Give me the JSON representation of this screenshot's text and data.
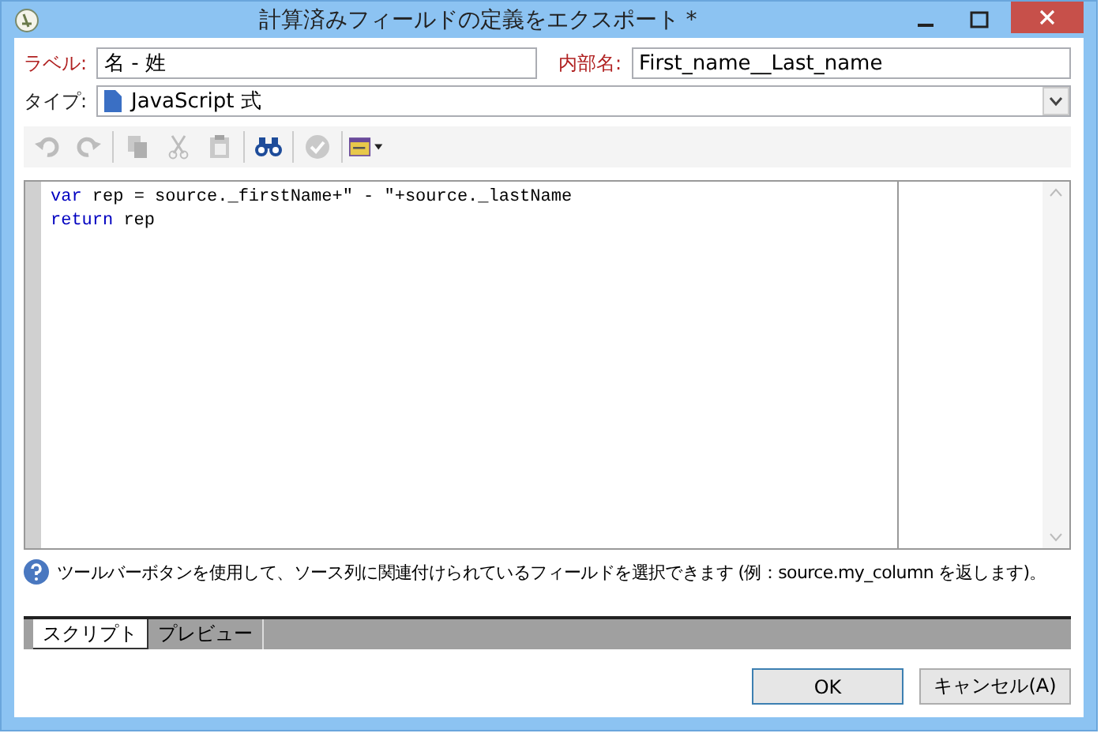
{
  "window": {
    "title": "計算済みフィールドの定義をエクスポート *"
  },
  "label_field": {
    "label": "ラベル:",
    "value": "名 - 姓"
  },
  "internal_name_field": {
    "label": "内部名:",
    "value": "First_name__Last_name"
  },
  "type_field": {
    "label": "タイプ:",
    "value": "JavaScript 式"
  },
  "toolbar": [
    {
      "kind": "undo",
      "disabled": true
    },
    {
      "kind": "redo",
      "disabled": true
    },
    {
      "kind": "sep"
    },
    {
      "kind": "copy",
      "disabled": true
    },
    {
      "kind": "cut",
      "disabled": true
    },
    {
      "kind": "paste",
      "disabled": true
    },
    {
      "kind": "sep"
    },
    {
      "kind": "find",
      "disabled": false
    },
    {
      "kind": "sep"
    },
    {
      "kind": "check",
      "disabled": true
    },
    {
      "kind": "sep"
    },
    {
      "kind": "fields",
      "disabled": false
    }
  ],
  "code_lines": [
    [
      {
        "kind": "keyword",
        "text": "var"
      },
      {
        "kind": "plain",
        "text": " rep = source._firstName+\" - \"+source._lastName"
      }
    ],
    [
      {
        "kind": "keyword",
        "text": "return"
      },
      {
        "kind": "plain",
        "text": " rep"
      }
    ]
  ],
  "help_text": "ツールバーボタンを使用して、ソース列に関連付けられているフィールドを選択できます (例：source.my_column を返します)。",
  "tabs": [
    {
      "label": "スクリプト",
      "selected": true
    },
    {
      "label": "プレビュー",
      "selected": false
    }
  ],
  "buttons": [
    {
      "label": "OK",
      "kind": "default"
    },
    {
      "label": "キャンセル(A)",
      "kind": "normal"
    }
  ]
}
